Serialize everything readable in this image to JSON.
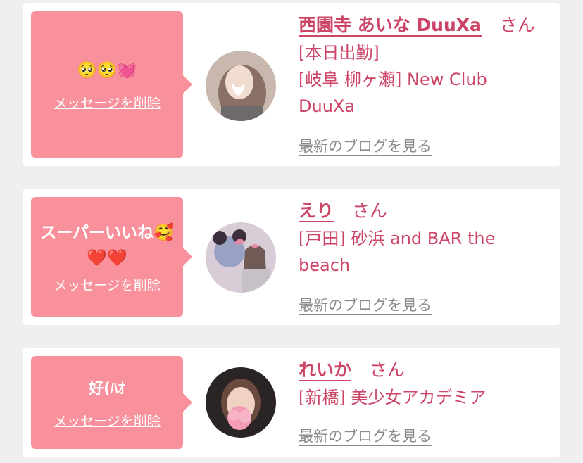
{
  "items": [
    {
      "message_emoji": "🥺🥺💓",
      "delete_label": "メッセージを削除",
      "name": "西園寺 あいな DuuXa",
      "honorific": "さん",
      "status": "[本日出勤]",
      "shop_line1": "[岐阜 柳ヶ瀬] New Club",
      "shop_line2": "DuuXa",
      "blog_label": "最新のブログを見る"
    },
    {
      "message_line1": "スーパーいいね🥰",
      "message_line2": "❤️❤️",
      "delete_label": "メッセージを削除",
      "name": "えり",
      "honorific": "さん",
      "shop_line1": "[戸田] 砂浜 and BAR the",
      "shop_line2": "beach",
      "blog_label": "最新のブログを見る"
    },
    {
      "message": "好(ﾊｵ",
      "delete_label": "メッセージを削除",
      "name": "れいか",
      "honorific": "さん",
      "shop_line1": "[新橋] 美少女アカデミア",
      "blog_label": "最新のブログを見る"
    }
  ],
  "colors": {
    "bubble": "#f8919b",
    "accent": "#cc4466",
    "card": "#ffffff",
    "background": "#efefef",
    "link_gray": "#8a8a8a"
  },
  "icons": [
    "avatar-photo",
    "heart-emoji",
    "pleading-face-emoji",
    "smiling-hearts-emoji"
  ]
}
